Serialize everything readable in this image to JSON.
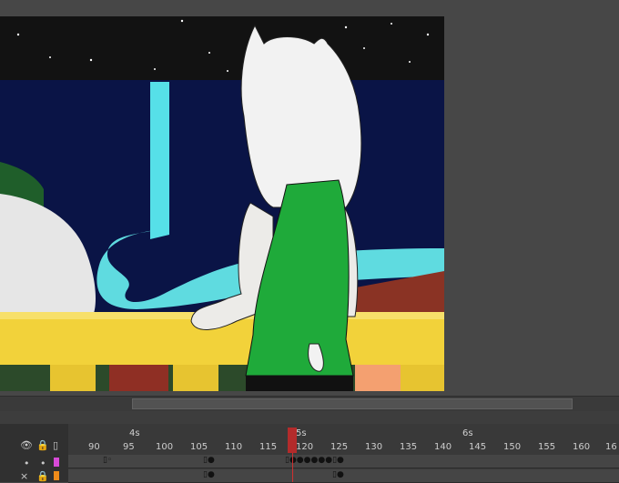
{
  "timeline": {
    "seconds": [
      "4s",
      "5s",
      "6s"
    ],
    "frame_numbers": [
      "90",
      "95",
      "100",
      "105",
      "110",
      "115",
      "120",
      "125",
      "130",
      "135",
      "140",
      "145",
      "150",
      "155",
      "160",
      "16"
    ],
    "current_frame": 119,
    "controls": {
      "eye_icon": "👁",
      "lock_icon": "🔒",
      "outline_icon": "▯",
      "layer1_dot": "•",
      "layer2_dot": "×"
    }
  },
  "colors": {
    "layer1": "#d84ad8",
    "layer2": "#ef8b1a",
    "playhead": "#b32b2b"
  }
}
